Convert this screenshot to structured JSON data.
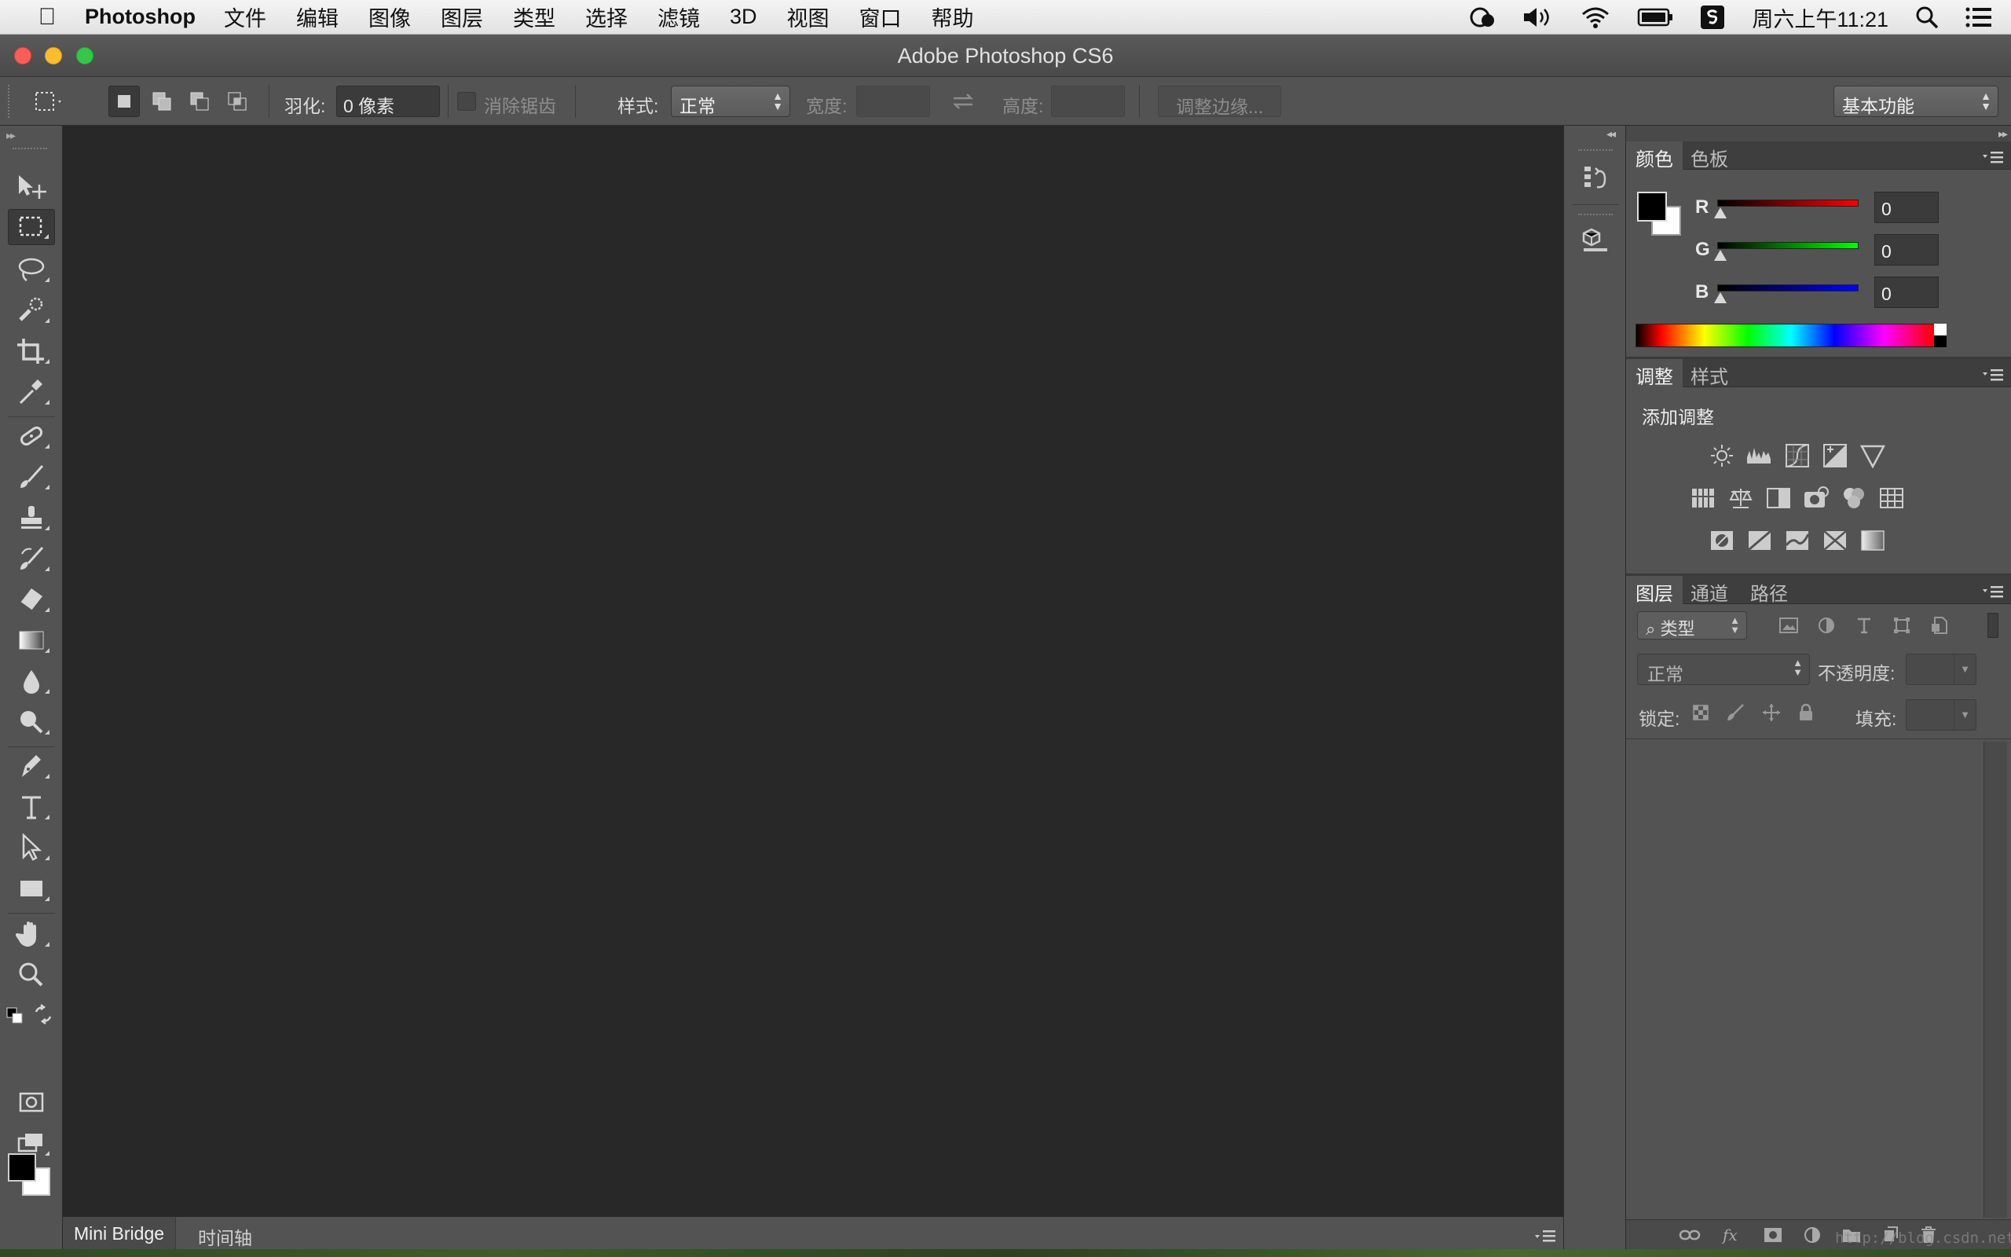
{
  "menubar": {
    "app_name": "Photoshop",
    "items": [
      "文件",
      "编辑",
      "图像",
      "图层",
      "类型",
      "选择",
      "滤镜",
      "3D",
      "视图",
      "窗口",
      "帮助"
    ],
    "clock": "周六上午11:21"
  },
  "window": {
    "title": "Adobe Photoshop CS6"
  },
  "options": {
    "feather_label": "羽化:",
    "feather_value": "0 像素",
    "antialias_label": "消除锯齿",
    "style_label": "样式:",
    "style_value": "正常",
    "width_label": "宽度:",
    "height_label": "高度:",
    "refine_edge": "调整边缘...",
    "workspace": "基本功能"
  },
  "bottom_panel": {
    "tabs": [
      "Mini Bridge",
      "时间轴"
    ]
  },
  "color_panel": {
    "tabs": [
      "颜色",
      "色板"
    ],
    "channels": [
      {
        "label": "R",
        "value": "0",
        "gradient_end": "#ff0000"
      },
      {
        "label": "G",
        "value": "0",
        "gradient_end": "#00ff00"
      },
      {
        "label": "B",
        "value": "0",
        "gradient_end": "#0000ff"
      }
    ]
  },
  "adjustments_panel": {
    "tabs": [
      "调整",
      "样式"
    ],
    "title": "添加调整"
  },
  "layers_panel": {
    "tabs": [
      "图层",
      "通道",
      "路径"
    ],
    "filter_value": "类型",
    "blend_mode": "正常",
    "opacity_label": "不透明度:",
    "lock_label": "锁定:",
    "fill_label": "填充:"
  },
  "watermark": "http://blog.csdn.net/",
  "colors": {
    "panel": "#535353",
    "canvas": "#282828",
    "foreground": "#000000",
    "background": "#ffffff"
  }
}
